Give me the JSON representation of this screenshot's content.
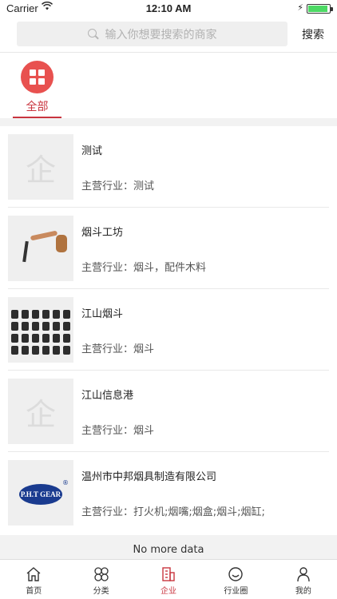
{
  "status_bar": {
    "carrier": "Carrier",
    "time": "12:10 AM"
  },
  "search": {
    "placeholder": "输入你想要搜索的商家",
    "button_label": "搜索"
  },
  "category_tab": {
    "label": "全部"
  },
  "companies": [
    {
      "name": "测试",
      "industry": "主营行业：测试",
      "image": "placeholder",
      "placeholder_char": "企"
    },
    {
      "name": "烟斗工坊",
      "industry": "主营行业：烟斗，配件木料",
      "image": "pipe-photo"
    },
    {
      "name": "江山烟斗",
      "industry": "主营行业：烟斗",
      "image": "keyboard-photo"
    },
    {
      "name": "江山信息港",
      "industry": "主营行业：烟斗",
      "image": "placeholder",
      "placeholder_char": "企"
    },
    {
      "name": "温州市中邦烟具制造有限公司",
      "industry": "主营行业：打火机;烟嘴;烟盒;烟斗;烟缸;",
      "image": "pht-gear-logo",
      "logo_text": "P.H.T GEAR"
    }
  ],
  "list_footer": "No more data",
  "tabbar": {
    "items": [
      {
        "label": "首页",
        "icon": "home-icon"
      },
      {
        "label": "分类",
        "icon": "category-icon"
      },
      {
        "label": "企业",
        "icon": "enterprise-icon"
      },
      {
        "label": "行业圈",
        "icon": "circle-icon"
      },
      {
        "label": "我的",
        "icon": "profile-icon"
      }
    ],
    "active_index": 2
  },
  "colors": {
    "accent": "#c9353f",
    "tab_circle": "#e8514f"
  }
}
